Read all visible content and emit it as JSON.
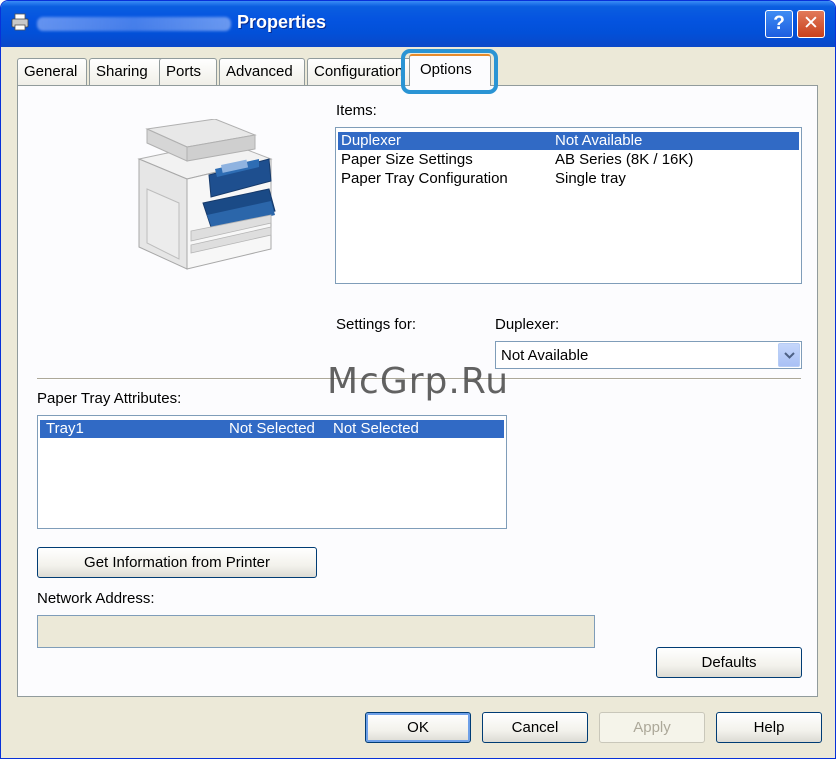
{
  "window": {
    "title": "Properties",
    "help_button": "?",
    "close_button": "✕"
  },
  "tabs": [
    {
      "label": "General"
    },
    {
      "label": "Sharing"
    },
    {
      "label": "Ports"
    },
    {
      "label": "Advanced"
    },
    {
      "label": "Configuration"
    },
    {
      "label": "Options",
      "active": true
    }
  ],
  "items": {
    "label": "Items:",
    "rows": [
      {
        "name": "Duplexer",
        "value": "Not Available",
        "selected": true
      },
      {
        "name": "Paper Size Settings",
        "value": "AB Series (8K / 16K)"
      },
      {
        "name": "Paper Tray Configuration",
        "value": "Single tray"
      }
    ]
  },
  "settings": {
    "label": "Settings for:",
    "target": "Duplexer:",
    "selected_value": "Not Available"
  },
  "paper_tray": {
    "label": "Paper Tray Attributes:",
    "rows": [
      {
        "name": "Tray1",
        "col2": "Not Selected",
        "col3": "Not Selected",
        "selected": true
      }
    ]
  },
  "get_info_button": "Get Information from Printer",
  "network_address": {
    "label": "Network Address:",
    "value": ""
  },
  "defaults_button": "Defaults",
  "footer": {
    "ok": "OK",
    "cancel": "Cancel",
    "apply": "Apply",
    "help": "Help"
  },
  "watermark": "McGrp.Ru",
  "colors": {
    "titlebar": "#0554e0",
    "selection": "#316ac5",
    "window_face": "#ece9d8",
    "highlight_ring": "#2a94d4",
    "active_tab_accent": "#e68b2c"
  }
}
